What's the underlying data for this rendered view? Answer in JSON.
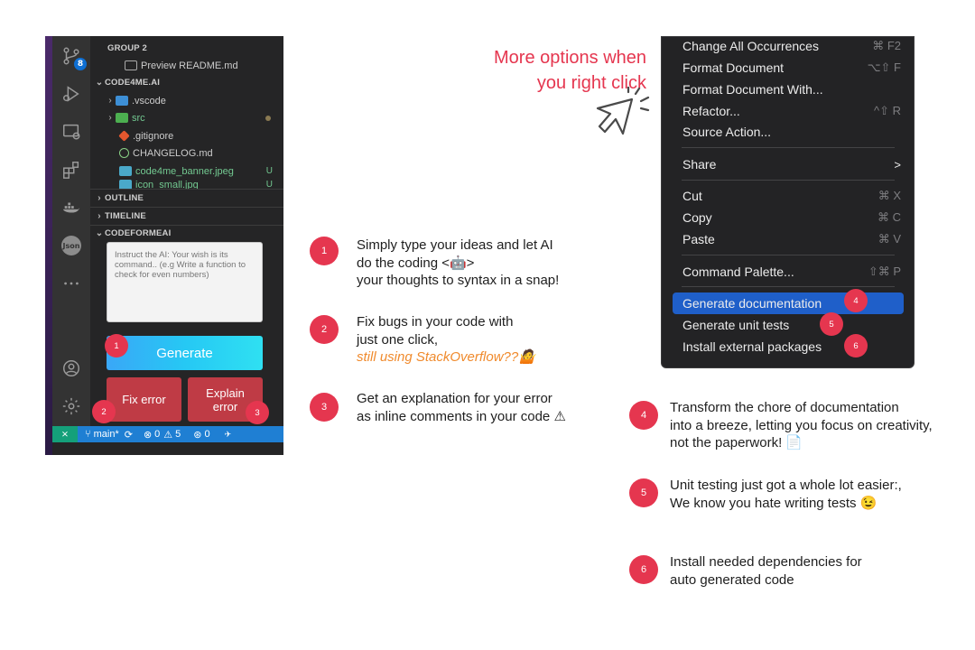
{
  "vscode": {
    "activity_badge": "8",
    "json_icon_label": "Json",
    "explorer": {
      "group_title": "GROUP 2",
      "preview_item": "Preview README.md",
      "project_title": "CODE4ME.AI",
      "items": [
        {
          "name": ".vscode",
          "status": ""
        },
        {
          "name": "src",
          "status": "dot"
        },
        {
          "name": ".gitignore",
          "status": ""
        },
        {
          "name": "CHANGELOG.md",
          "status": ""
        },
        {
          "name": "code4me_banner.jpeg",
          "status": "U"
        },
        {
          "name": "icon_small.jpg",
          "status": "U"
        }
      ]
    },
    "outline_label": "OUTLINE",
    "timeline_label": "TIMELINE",
    "extension_title": "CODEFORMEAI",
    "prompt_placeholder": "Instruct the AI: Your wish is its command.. (e.g Write a function to check for even numbers)",
    "generate_label": "Generate",
    "fix_error_label": "Fix error",
    "explain_error_label": "Explain error",
    "status": {
      "branch": "main*",
      "errors": "0",
      "warnings": "5",
      "ports": "0"
    }
  },
  "badges": [
    "1",
    "2",
    "3",
    "4",
    "5",
    "6"
  ],
  "callouts_left": [
    {
      "num": "1",
      "line1": "Simply type your ideas and let AI",
      "line2": "do the coding <🤖>",
      "line3": "your thoughts to syntax in a snap!"
    },
    {
      "num": "2",
      "line1": "Fix bugs in your code with",
      "line2": "just one click,",
      "line3": "still using StackOverflow??🤷"
    },
    {
      "num": "3",
      "line1": "Get an explanation for your error",
      "line2": "as inline comments in your code ⚠"
    }
  ],
  "more_options": "More options when you right click",
  "menu": {
    "items": [
      {
        "label": "Change All Occurrences",
        "shortcut": "⌘ F2"
      },
      {
        "label": "Format Document",
        "shortcut": "⌥⇧ F"
      },
      {
        "label": "Format Document With...",
        "shortcut": ""
      },
      {
        "label": "Refactor...",
        "shortcut": "^⇧ R"
      },
      {
        "label": "Source Action...",
        "shortcut": ""
      },
      {
        "label": "Share",
        "shortcut": ">"
      },
      {
        "label": "Cut",
        "shortcut": "⌘ X"
      },
      {
        "label": "Copy",
        "shortcut": "⌘ C"
      },
      {
        "label": "Paste",
        "shortcut": "⌘ V"
      },
      {
        "label": "Command Palette...",
        "shortcut": "⇧⌘ P"
      },
      {
        "label": "Generate documentation",
        "shortcut": ""
      },
      {
        "label": "Generate unit tests",
        "shortcut": ""
      },
      {
        "label": "Install external packages",
        "shortcut": ""
      }
    ]
  },
  "callouts_right": [
    {
      "num": "4",
      "line1": "Transform the chore of documentation",
      "line2": "into a breeze, letting you focus on creativity,",
      "line3": "not the paperwork! 📄"
    },
    {
      "num": "5",
      "line1": "Unit testing just got a whole lot easier:,",
      "line2": "We know you hate writing tests 😉"
    },
    {
      "num": "6",
      "line1": "Install needed dependencies for",
      "line2": "auto generated code"
    }
  ],
  "colors": {
    "accent": "#e5364f",
    "vscode_blue": "#1f7fd3",
    "menu_highlight": "#1f5fc9",
    "error_button": "#bf3b45",
    "italic_orange": "#f08a2c"
  }
}
